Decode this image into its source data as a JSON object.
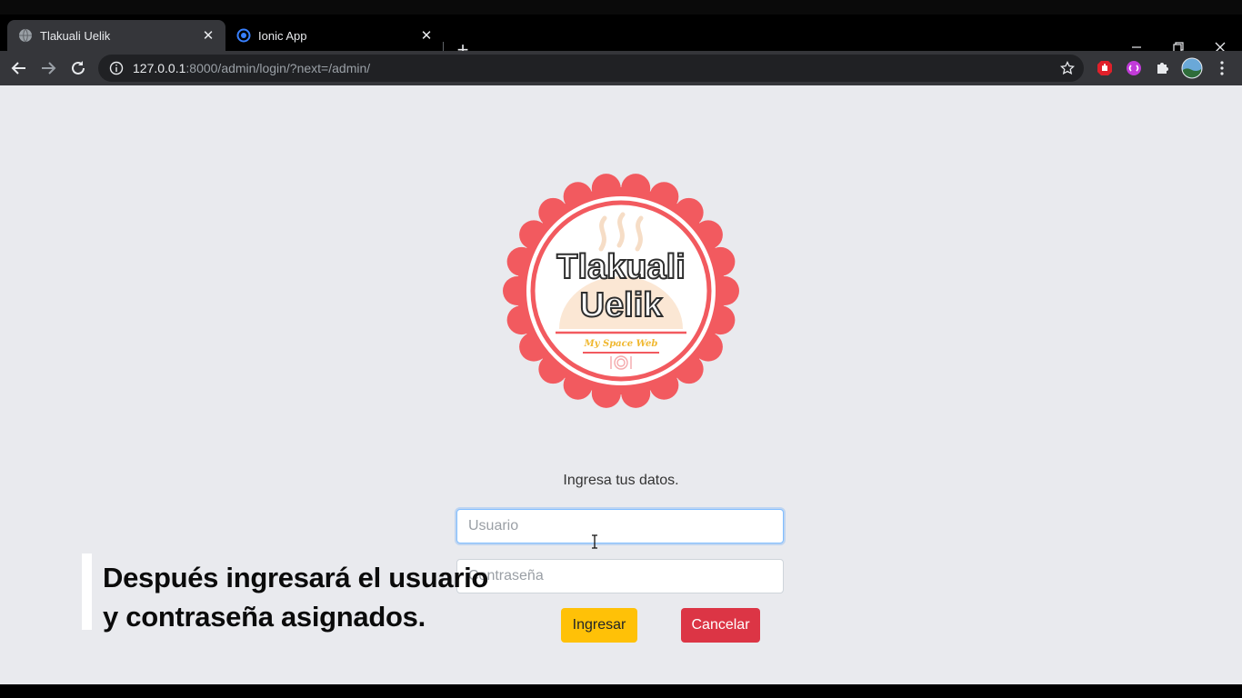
{
  "browser": {
    "tabs": [
      {
        "title": "Tlakuali Uelik",
        "active": true,
        "favicon": "globe-icon"
      },
      {
        "title": "Ionic App",
        "active": false,
        "favicon": "ionic-icon"
      }
    ],
    "url": {
      "host": "127.0.0.1",
      "rest": ":8000/admin/login/?next=/admin/"
    }
  },
  "logo": {
    "line1": "Tlakuali",
    "line2": "Uelik",
    "tagline": "My Space Web",
    "colors": {
      "ring": "#f25a5f",
      "text": "#3a3a3a",
      "tagline": "#f0b830"
    }
  },
  "login": {
    "subtitle": "Ingresa tus datos.",
    "username_placeholder": "Usuario",
    "password_placeholder": "Contraseña",
    "submit_label": "Ingresar",
    "cancel_label": "Cancelar",
    "colors": {
      "submit": "#ffc107",
      "cancel": "#dc3545"
    }
  },
  "caption": {
    "line1": "Después ingresará el usuario",
    "line2": "y contraseña asignados."
  }
}
